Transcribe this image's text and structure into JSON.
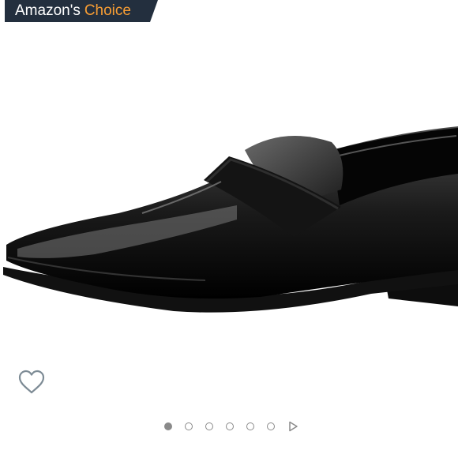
{
  "badge": {
    "prefix": "Amazon's",
    "highlight": "Choice",
    "bg_color": "#232f3e",
    "highlight_color": "#f79d34"
  },
  "product": {
    "image_icon": "black-patent-leather-loafer"
  },
  "wishlist": {
    "icon": "heart-outline-icon"
  },
  "carousel": {
    "total_images": 6,
    "current_index": 1,
    "next_icon": "play-triangle-icon"
  }
}
